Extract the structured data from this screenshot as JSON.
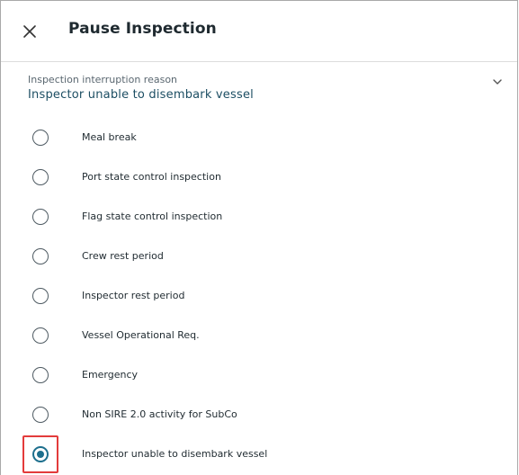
{
  "dialog": {
    "title": "Pause Inspection",
    "close_icon": "close-icon"
  },
  "reason_select": {
    "label": "Inspection interruption reason",
    "value": "Inspector unable to disembark vessel",
    "chevron_icon": "chevron-down-icon"
  },
  "options": [
    {
      "label": "Meal break",
      "checked": false
    },
    {
      "label": "Port state control inspection",
      "checked": false
    },
    {
      "label": "Flag state control inspection",
      "checked": false
    },
    {
      "label": "Crew rest period",
      "checked": false
    },
    {
      "label": "Inspector rest period",
      "checked": false
    },
    {
      "label": "Vessel Operational Req.",
      "checked": false
    },
    {
      "label": "Emergency",
      "checked": false
    },
    {
      "label": "Non SIRE 2.0 activity for SubCo",
      "checked": false
    },
    {
      "label": "Inspector unable to disembark vessel",
      "checked": true
    }
  ],
  "colors": {
    "accent": "#1d6f8d",
    "highlight": "#e33b3b"
  }
}
